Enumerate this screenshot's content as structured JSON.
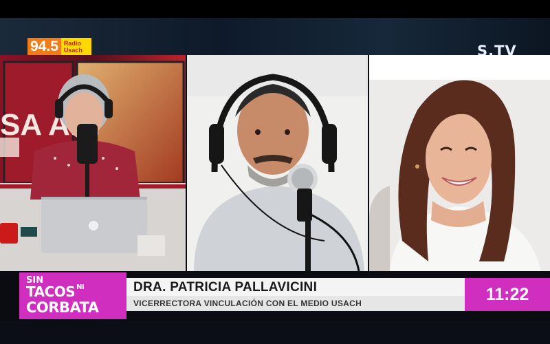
{
  "radio_logo": {
    "frequency": "94.5",
    "name_line1": "Radio",
    "name_line2": "Usach"
  },
  "channel_logo": "S.TV",
  "studio_sign": "SA ADI",
  "lower_third": {
    "show_line1": "SIN",
    "show_line2": "TACOS",
    "show_line2_small": "NI",
    "show_line3": "CORBATA",
    "guest_name": "DRA. PATRICIA PALLAVICINI",
    "guest_role": "VICERRECTORA VINCULACIÓN CON EL MEDIO USACH",
    "clock": "11:22"
  },
  "colors": {
    "accent_magenta": "#cf2ebf",
    "radio_orange": "#f07d1a",
    "radio_yellow": "#ffd800"
  }
}
